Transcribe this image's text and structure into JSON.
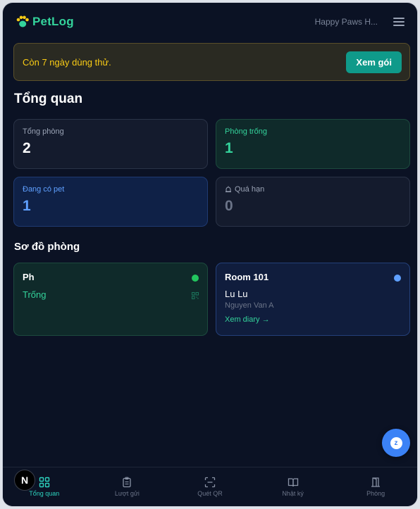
{
  "header": {
    "brand": "PetLog",
    "org_name": "Happy Paws H...",
    "menu_icon": "hamburger-menu-icon"
  },
  "trial": {
    "message": "Còn 7 ngày dùng thử.",
    "button_label": "Xem gói"
  },
  "overview": {
    "title": "Tổng quan",
    "stats": [
      {
        "label": "Tổng phòng",
        "value": "2"
      },
      {
        "label": "Phòng trống",
        "value": "1"
      },
      {
        "label": "Đang có pet",
        "value": "1"
      },
      {
        "label": "Quá hạn",
        "value": "0",
        "icon": "alarm-icon"
      }
    ]
  },
  "rooms": {
    "title": "Sơ đồ phòng",
    "items": [
      {
        "name": "Ph",
        "status": "Trống",
        "status_color": "#22c55e"
      },
      {
        "name": "Room 101",
        "pet_name": "Lu Lu",
        "owner": "Nguyen Van A",
        "link": "Xem diary →",
        "status_color": "#5fa0ff"
      }
    ]
  },
  "bottom_nav": {
    "items": [
      {
        "label": "Tổng quan",
        "icon": "grid-icon",
        "active": true
      },
      {
        "label": "Lượt gửi",
        "icon": "clipboard-icon"
      },
      {
        "label": "Quét QR",
        "icon": "scan-icon"
      },
      {
        "label": "Nhật ký",
        "icon": "book-icon"
      },
      {
        "label": "Phòng",
        "icon": "door-icon"
      }
    ]
  },
  "dev_badge": "N",
  "colors": {
    "accent": "#34d39b",
    "background": "#0b1224",
    "trial_text": "#facc15",
    "info_blue": "#5fa0ff"
  }
}
